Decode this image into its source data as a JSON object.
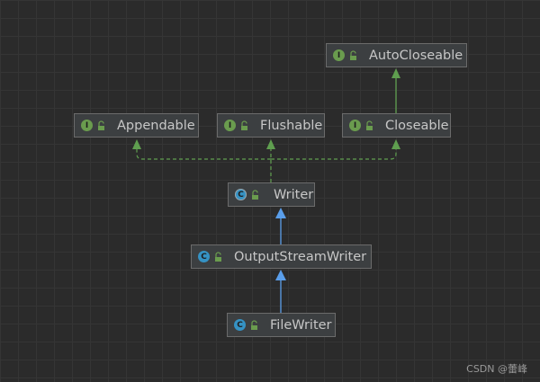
{
  "colors": {
    "background": "#2b2b2b",
    "node_fill": "#3c3f41",
    "node_border": "#6b6b6b",
    "interface_icon": "#6a9c4e",
    "class_icon": "#3592c4",
    "implements_edge": "#5f9e4f",
    "extends_edge": "#5a9eea"
  },
  "nodes": [
    {
      "key": "autocloseable",
      "label": "AutoCloseable",
      "kind": "interface",
      "icon": "interface-icon"
    },
    {
      "key": "appendable",
      "label": "Appendable",
      "kind": "interface",
      "icon": "interface-icon"
    },
    {
      "key": "flushable",
      "label": "Flushable",
      "kind": "interface",
      "icon": "interface-icon"
    },
    {
      "key": "closeable",
      "label": "Closeable",
      "kind": "interface",
      "icon": "interface-icon"
    },
    {
      "key": "writer",
      "label": "Writer",
      "kind": "abstract-class",
      "icon": "abstract-class-icon"
    },
    {
      "key": "outputstreamwriter",
      "label": "OutputStreamWriter",
      "kind": "class",
      "icon": "class-icon"
    },
    {
      "key": "filewriter",
      "label": "FileWriter",
      "kind": "class",
      "icon": "class-icon"
    }
  ],
  "edges": [
    {
      "from": "closeable",
      "to": "autocloseable",
      "type": "extends-interface"
    },
    {
      "from": "writer",
      "to": "appendable",
      "type": "implements"
    },
    {
      "from": "writer",
      "to": "flushable",
      "type": "implements"
    },
    {
      "from": "writer",
      "to": "closeable",
      "type": "implements"
    },
    {
      "from": "outputstreamwriter",
      "to": "writer",
      "type": "extends"
    },
    {
      "from": "filewriter",
      "to": "outputstreamwriter",
      "type": "extends"
    }
  ],
  "watermark": "CSDN @蕾峰"
}
